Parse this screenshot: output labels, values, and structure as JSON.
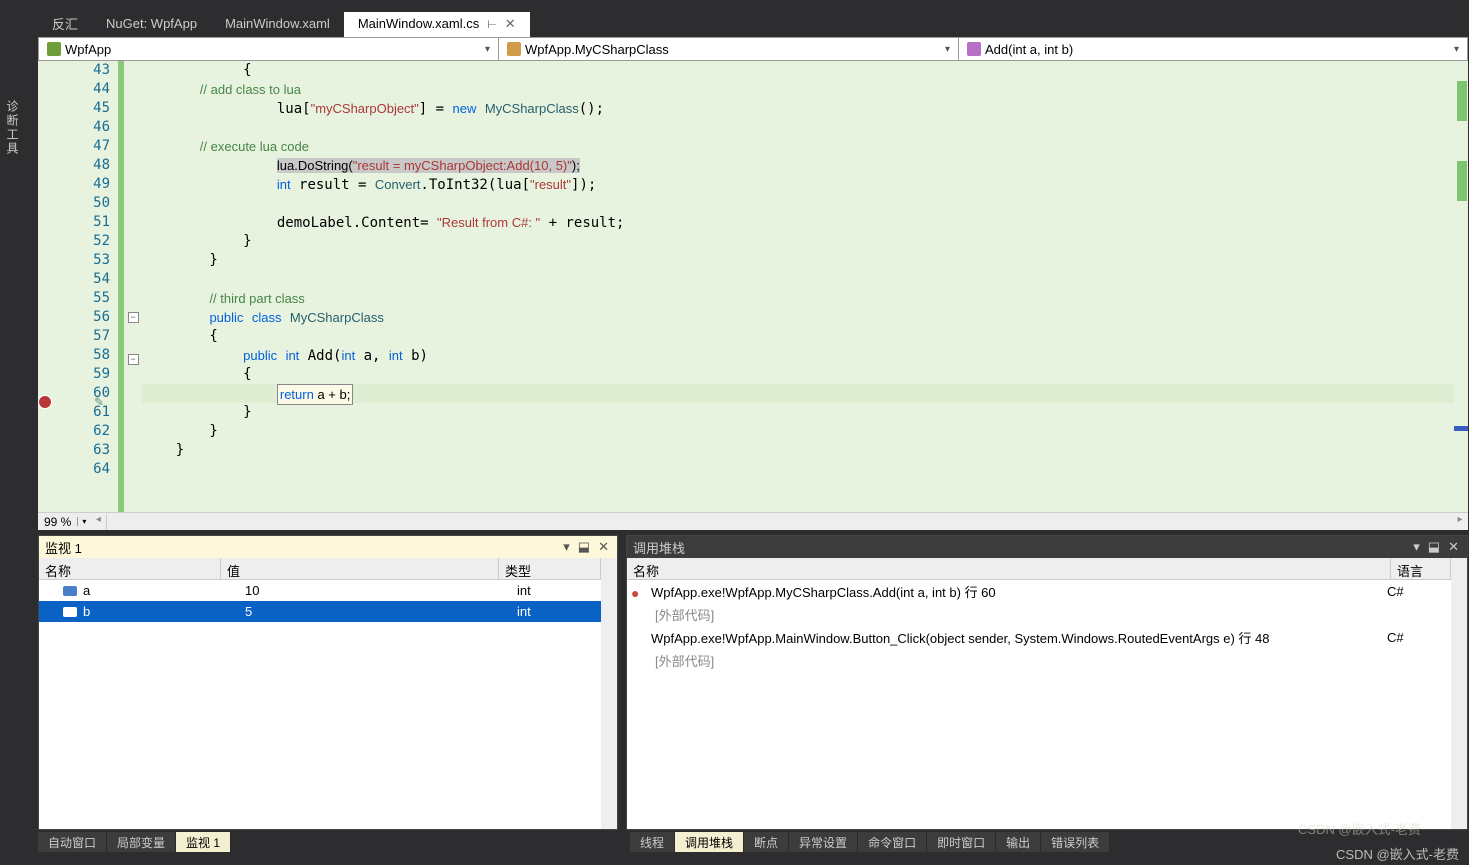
{
  "sideLabel": "诊断工具",
  "tabs": [
    {
      "label": "反汇",
      "active": false
    },
    {
      "label": "NuGet: WpfApp",
      "active": false
    },
    {
      "label": "MainWindow.xaml",
      "active": false
    },
    {
      "label": "MainWindow.xaml.cs",
      "active": true
    }
  ],
  "nav": {
    "project": "WpfApp",
    "class": "WpfApp.MyCSharpClass",
    "member": "Add(int a, int b)"
  },
  "zoom": "99 %",
  "firstLine": 43,
  "lastLine": 64,
  "breakpointLine": 60,
  "code": [
    {
      "n": 43,
      "t": "            {"
    },
    {
      "n": 44,
      "t": "                // add class to lua",
      "cls": "com"
    },
    {
      "n": 45,
      "html": "                lua[<span class='str'>\"myCSharpObject\"</span>] = <span class='kw'>new</span> <span class='typ'>MyCSharpClass</span>();"
    },
    {
      "n": 46,
      "t": ""
    },
    {
      "n": 47,
      "t": "                // execute lua code",
      "cls": "com"
    },
    {
      "n": 48,
      "html": "                <span class='sel-gray'>lua.DoString(<span class='str'>\"result = myCSharpObject:Add(10, 5)\"</span>);</span>"
    },
    {
      "n": 49,
      "html": "                <span class='kw'>int</span> result = <span class='typ'>Convert</span>.ToInt32(lua[<span class='str'>\"result\"</span>]);"
    },
    {
      "n": 50,
      "t": ""
    },
    {
      "n": 51,
      "html": "                demoLabel.Content= <span class='str'>\"Result from C#: \"</span> + result;"
    },
    {
      "n": 52,
      "t": "            }"
    },
    {
      "n": 53,
      "t": "        }"
    },
    {
      "n": 54,
      "t": ""
    },
    {
      "n": 55,
      "html": "        <span class='com'>// third part class</span>"
    },
    {
      "n": 56,
      "html": "        <span class='kw'>public</span> <span class='kw'>class</span> <span class='typ'>MyCSharpClass</span>",
      "fold": true
    },
    {
      "n": 57,
      "t": "        {"
    },
    {
      "n": 58,
      "html": "            <span class='kw'>public</span> <span class='kw'>int</span> Add(<span class='kw'>int</span> a, <span class='kw'>int</span> b)",
      "fold": true
    },
    {
      "n": 59,
      "t": "            {"
    },
    {
      "n": 60,
      "html": "                <span class='sel-box'><span class='kw'>return</span> a + b;</span>",
      "hl": true
    },
    {
      "n": 61,
      "t": "            }"
    },
    {
      "n": 62,
      "t": "        }"
    },
    {
      "n": 63,
      "t": "    }"
    },
    {
      "n": 64,
      "t": ""
    }
  ],
  "watch": {
    "title": "监视 1",
    "headers": {
      "name": "名称",
      "value": "值",
      "type": "类型"
    },
    "rows": [
      {
        "name": "a",
        "value": "10",
        "type": "int",
        "sel": false
      },
      {
        "name": "b",
        "value": "5",
        "type": "int",
        "sel": true
      }
    ]
  },
  "callstack": {
    "title": "调用堆栈",
    "headers": {
      "name": "名称",
      "lang": "语言"
    },
    "externalLabel": "[外部代码]",
    "rows": [
      {
        "name": "WpfApp.exe!WpfApp.MyCSharpClass.Add(int a, int b) 行 60",
        "lang": "C#",
        "current": true
      },
      {
        "name": "[外部代码]",
        "ext": true
      },
      {
        "name": "WpfApp.exe!WpfApp.MainWindow.Button_Click(object sender, System.Windows.RoutedEventArgs e) 行 48",
        "lang": "C#"
      },
      {
        "name": "[外部代码]",
        "ext": true
      }
    ]
  },
  "bottomTabs": {
    "left": [
      {
        "label": "自动窗口"
      },
      {
        "label": "局部变量"
      },
      {
        "label": "监视 1",
        "active": true
      }
    ],
    "right": [
      {
        "label": "线程"
      },
      {
        "label": "调用堆栈",
        "active": true
      },
      {
        "label": "断点"
      },
      {
        "label": "异常设置"
      },
      {
        "label": "命令窗口"
      },
      {
        "label": "即时窗口"
      },
      {
        "label": "输出"
      },
      {
        "label": "错误列表"
      }
    ]
  },
  "watermark": "CSDN @嵌入式-老费"
}
